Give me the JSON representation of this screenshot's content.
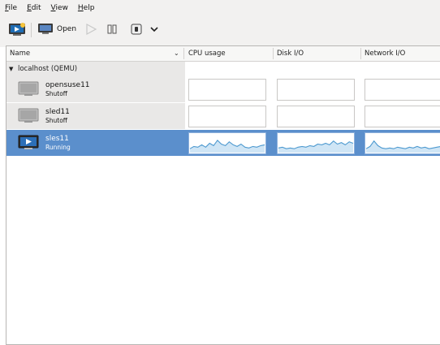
{
  "menu": {
    "file": {
      "accel": "F",
      "rest": "ile"
    },
    "edit": {
      "accel": "E",
      "rest": "dit"
    },
    "view": {
      "accel": "V",
      "rest": "iew"
    },
    "help": {
      "accel": "H",
      "rest": "elp"
    }
  },
  "toolbar": {
    "open_label": "Open",
    "icons": [
      "new-vm-icon",
      "monitor-icon",
      "run-icon",
      "pause-icon",
      "shutdown-icon",
      "chevron-down-icon"
    ]
  },
  "columns": {
    "name": "Name",
    "sort_indicator": "⌄",
    "cpu": "CPU usage",
    "disk": "Disk I/O",
    "network": "Network I/O"
  },
  "group": {
    "expander": "▼",
    "label": "localhost (QEMU)"
  },
  "vms": [
    {
      "name": "opensuse11",
      "status": "Shutoff",
      "state": "off"
    },
    {
      "name": "sled11",
      "status": "Shutoff",
      "state": "off"
    },
    {
      "name": "sles11",
      "status": "Running",
      "state": "running"
    }
  ],
  "graphs": {
    "sles11": {
      "cpu": [
        0.2,
        0.35,
        0.3,
        0.45,
        0.3,
        0.55,
        0.4,
        0.75,
        0.5,
        0.4,
        0.65,
        0.45,
        0.35,
        0.5,
        0.3,
        0.25,
        0.35,
        0.3,
        0.4,
        0.45
      ],
      "disk": [
        0.25,
        0.3,
        0.2,
        0.25,
        0.2,
        0.3,
        0.35,
        0.3,
        0.4,
        0.35,
        0.5,
        0.45,
        0.55,
        0.45,
        0.7,
        0.5,
        0.6,
        0.45,
        0.65,
        0.55
      ],
      "network": [
        0.2,
        0.35,
        0.7,
        0.4,
        0.25,
        0.2,
        0.25,
        0.2,
        0.3,
        0.25,
        0.2,
        0.3,
        0.25,
        0.35,
        0.25,
        0.3,
        0.2,
        0.25,
        0.3,
        0.35
      ]
    }
  },
  "colors": {
    "selection": "#5b8fcc",
    "graph_line": "#4e9ad0",
    "graph_fill": "#cfe5f5"
  }
}
